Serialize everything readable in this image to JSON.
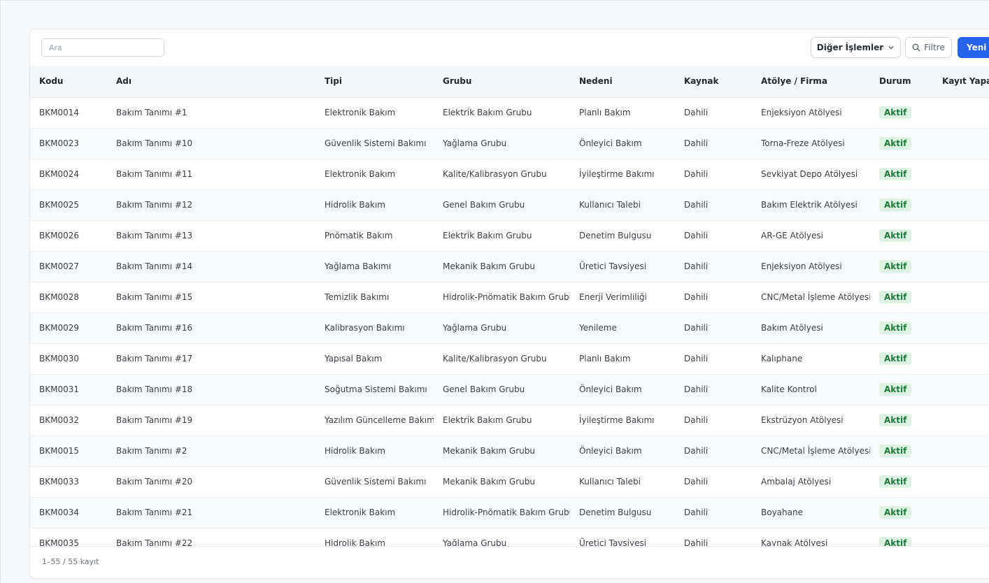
{
  "toolbar": {
    "search_placeholder": "Ara",
    "search_value": "",
    "more_actions_label": "Diğer İşlemler",
    "filter_label": "Filtre",
    "new_label": "Yeni B"
  },
  "table": {
    "columns": [
      "Kodu",
      "Adı",
      "Tipi",
      "Grubu",
      "Nedeni",
      "Kaynak",
      "Atölye / Firma",
      "Durum",
      "Kayıt Yapan"
    ],
    "rows": [
      [
        "BKM0014",
        "Bakım Tanımı #1",
        "Elektronik Bakım",
        "Elektrik Bakım Grubu",
        "Planlı Bakım",
        "Dahili",
        "Enjeksiyon Atölyesi",
        "Aktif",
        ""
      ],
      [
        "BKM0023",
        "Bakım Tanımı #10",
        "Güvenlik Sistemi Bakımı",
        "Yağlama Grubu",
        "Önleyici Bakım",
        "Dahili",
        "Torna-Freze Atölyesi",
        "Aktif",
        ""
      ],
      [
        "BKM0024",
        "Bakım Tanımı #11",
        "Elektronik Bakım",
        "Kalite/Kalibrasyon Grubu",
        "İyileştirme Bakımı",
        "Dahili",
        "Sevkiyat Depo Atölyesi",
        "Aktif",
        ""
      ],
      [
        "BKM0025",
        "Bakım Tanımı #12",
        "Hidrolik Bakım",
        "Genel Bakım Grubu",
        "Kullanıcı Talebi",
        "Dahili",
        "Bakım Elektrik Atölyesi",
        "Aktif",
        ""
      ],
      [
        "BKM0026",
        "Bakım Tanımı #13",
        "Pnömatik Bakım",
        "Elektrik Bakım Grubu",
        "Denetim Bulgusu",
        "Dahili",
        "AR-GE Atölyesi",
        "Aktif",
        ""
      ],
      [
        "BKM0027",
        "Bakım Tanımı #14",
        "Yağlama Bakımı",
        "Mekanik Bakım Grubu",
        "Üretici Tavsiyesi",
        "Dahili",
        "Enjeksiyon Atölyesi",
        "Aktif",
        ""
      ],
      [
        "BKM0028",
        "Bakım Tanımı #15",
        "Temizlik Bakımı",
        "Hidrolik-Pnömatik Bakım Grubu",
        "Enerji Verimliliği",
        "Dahili",
        "CNC/Metal İşleme Atölyesi",
        "Aktif",
        ""
      ],
      [
        "BKM0029",
        "Bakım Tanımı #16",
        "Kalibrasyon Bakımı",
        "Yağlama Grubu",
        "Yenileme",
        "Dahili",
        "Bakım Atölyesi",
        "Aktif",
        ""
      ],
      [
        "BKM0030",
        "Bakım Tanımı #17",
        "Yapısal Bakım",
        "Kalite/Kalibrasyon Grubu",
        "Planlı Bakım",
        "Dahili",
        "Kalıphane",
        "Aktif",
        ""
      ],
      [
        "BKM0031",
        "Bakım Tanımı #18",
        "Soğutma Sistemi Bakımı",
        "Genel Bakım Grubu",
        "Önleyici Bakım",
        "Dahili",
        "Kalite Kontrol",
        "Aktif",
        ""
      ],
      [
        "BKM0032",
        "Bakım Tanımı #19",
        "Yazılım Güncelleme Bakımı",
        "Elektrik Bakım Grubu",
        "İyileştirme Bakımı",
        "Dahili",
        "Ekstrüzyon Atölyesi",
        "Aktif",
        ""
      ],
      [
        "BKM0015",
        "Bakım Tanımı #2",
        "Hidrolik Bakım",
        "Mekanik Bakım Grubu",
        "Önleyici Bakım",
        "Dahili",
        "CNC/Metal İşleme Atölyesi",
        "Aktif",
        ""
      ],
      [
        "BKM0033",
        "Bakım Tanımı #20",
        "Güvenlik Sistemi Bakımı",
        "Mekanik Bakım Grubu",
        "Kullanıcı Talebi",
        "Dahili",
        "Ambalaj Atölyesi",
        "Aktif",
        ""
      ],
      [
        "BKM0034",
        "Bakım Tanımı #21",
        "Elektronik Bakım",
        "Hidrolik-Pnömatik Bakım Grubu",
        "Denetim Bulgusu",
        "Dahili",
        "Boyahane",
        "Aktif",
        ""
      ],
      [
        "BKM0035",
        "Bakım Tanımı #22",
        "Hidrolik Bakım",
        "Yağlama Grubu",
        "Üretici Tavsiyesi",
        "Dahili",
        "Kaynak Atölyesi",
        "Aktif",
        ""
      ]
    ]
  },
  "footer": {
    "record_count": "1–55 / 55 kayıt"
  },
  "colors": {
    "primary": "#2563eb",
    "status_active_bg": "#def2e4",
    "status_active_text": "#1e7a3c"
  }
}
